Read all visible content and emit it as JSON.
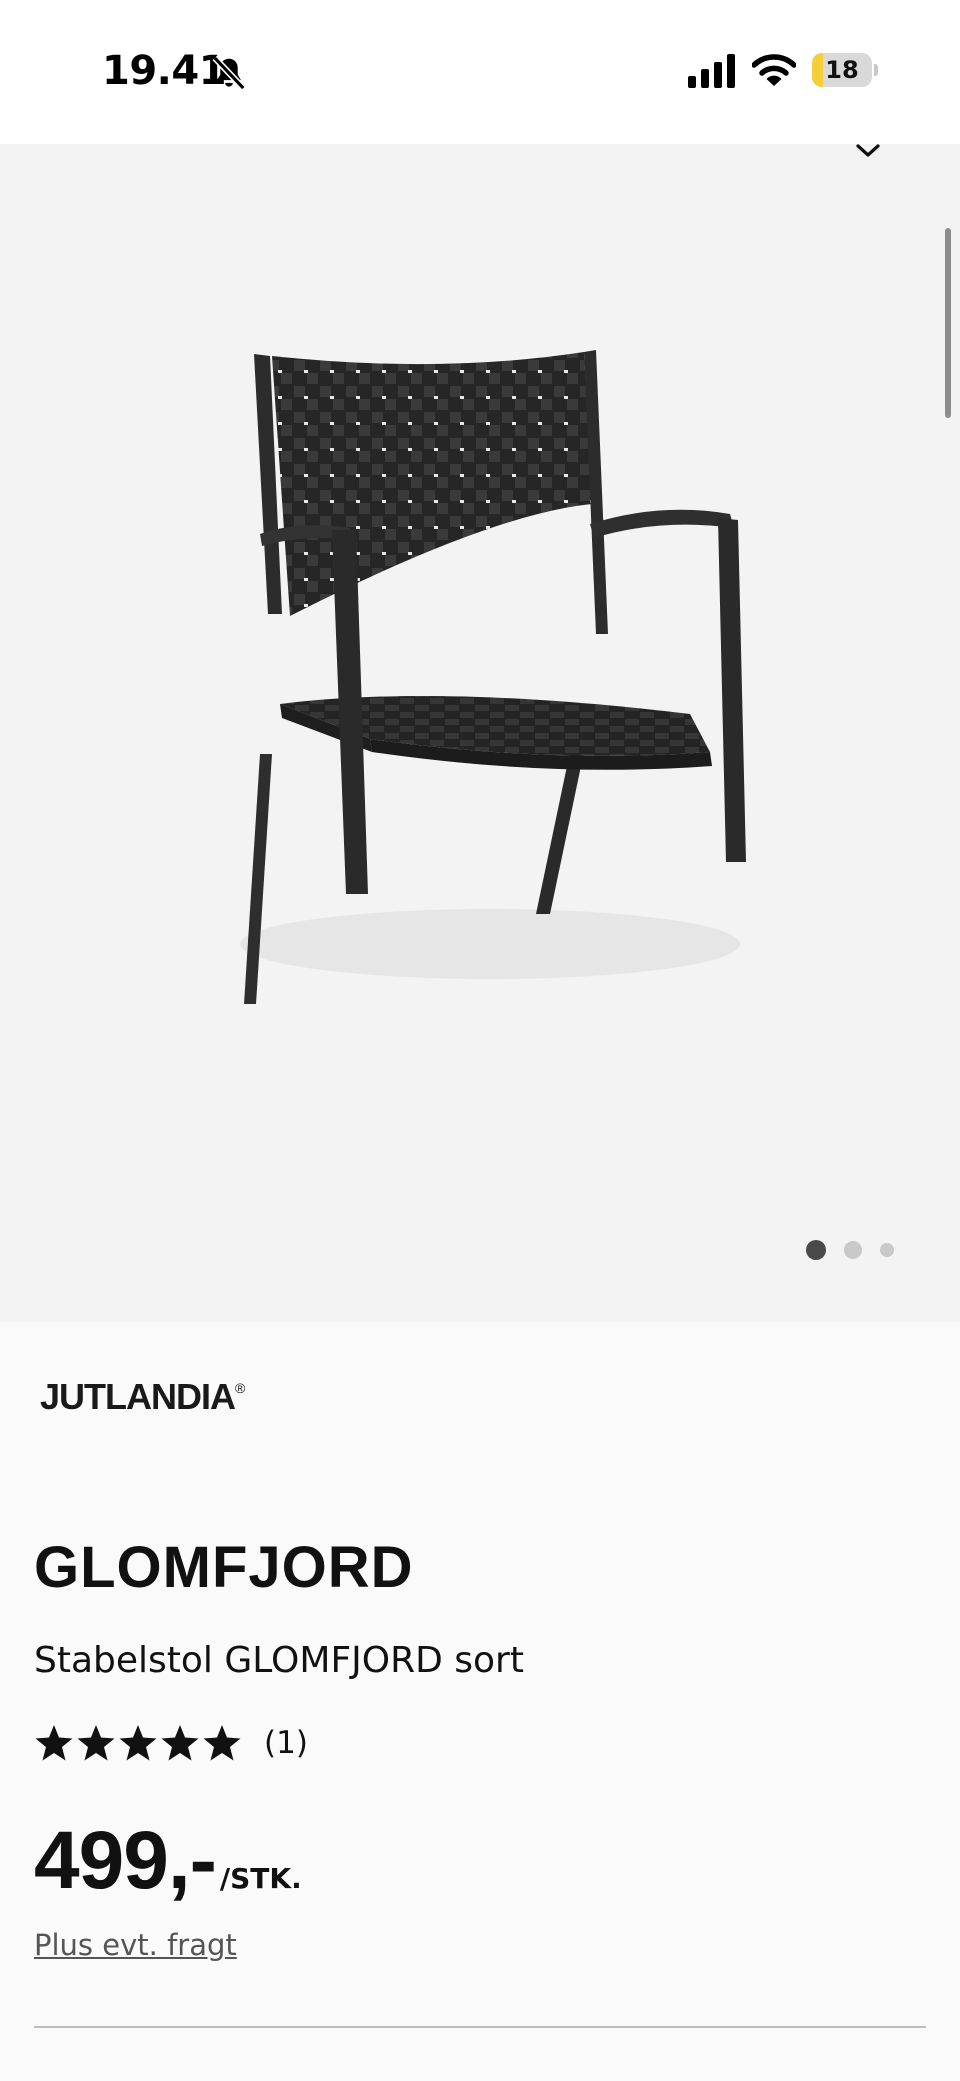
{
  "status_bar": {
    "time": "19.41",
    "battery_level": "18",
    "battery_fraction": 0.18,
    "accent_color": "#f5cf3a"
  },
  "gallery": {
    "image_subject": "chair-image",
    "slide_count": 3,
    "active_slide": 1,
    "collapse_icon": "chevron-down-icon"
  },
  "product": {
    "brand": "JUTLANDIA",
    "brand_mark": "®",
    "name": "GLOMFJORD",
    "description": "Stabelstol GLOMFJORD sort",
    "rating": {
      "stars": 5,
      "count_label": "(1)",
      "icon": "star-icon"
    },
    "price": "499,-",
    "price_unit": "/STK.",
    "freight_link": "Plus evt. fragt"
  }
}
